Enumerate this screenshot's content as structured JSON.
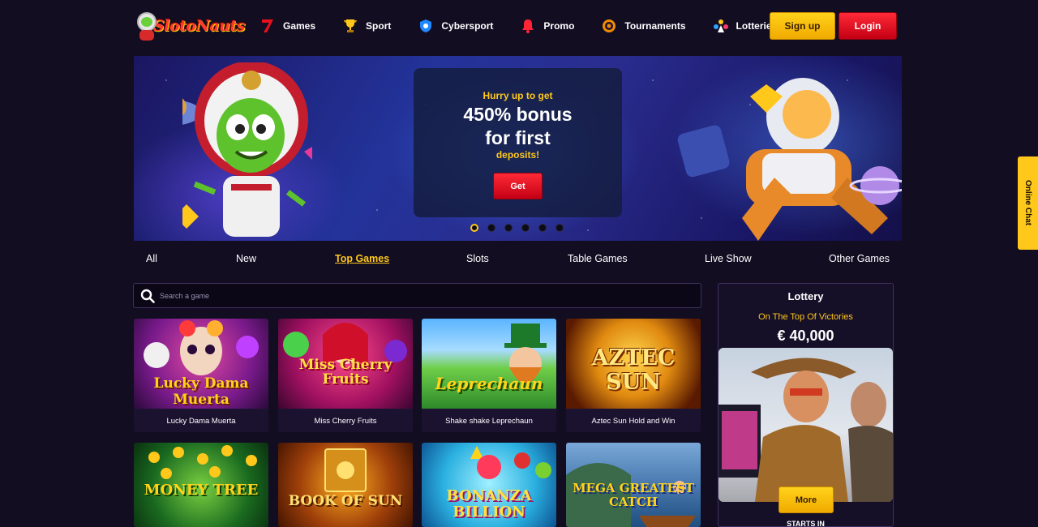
{
  "header": {
    "logo_text": "SlotoNauts",
    "nav": [
      {
        "label": "Games",
        "icon": "seven-icon"
      },
      {
        "label": "Sport",
        "icon": "trophy-icon"
      },
      {
        "label": "Cybersport",
        "icon": "shield-icon"
      },
      {
        "label": "Promo",
        "icon": "bell-icon"
      },
      {
        "label": "Tournaments",
        "icon": "gear-icon"
      },
      {
        "label": "Lotteries",
        "icon": "lottery-icon"
      }
    ],
    "signup_label": "Sign up",
    "login_label": "Login"
  },
  "banner": {
    "pre": "Hurry up to get",
    "main_line1": "450% bonus",
    "main_line2": "for first",
    "post": "deposits!",
    "button": "Get",
    "slide_count": 6,
    "active_slide": 1
  },
  "tabs": [
    "All",
    "New",
    "Top Games",
    "Slots",
    "Table Games",
    "Live Show",
    "Other Games"
  ],
  "active_tab": "Top Games",
  "search": {
    "placeholder": "Search a game"
  },
  "games": [
    {
      "name": "Lucky Dama Muerta",
      "thumb_title": "Lucky Dama Muerta"
    },
    {
      "name": "Miss Cherry Fruits",
      "thumb_title": "Miss Cherry Fruits"
    },
    {
      "name": "Shake shake Leprechaun",
      "thumb_title": "Leprechaun"
    },
    {
      "name": "Aztec Sun Hold and Win",
      "thumb_title": "AZTEC SUN"
    },
    {
      "name": "",
      "thumb_title": "MONEY TREE"
    },
    {
      "name": "",
      "thumb_title": "BOOK OF SUN"
    },
    {
      "name": "",
      "thumb_title": "BONANZA BILLION"
    },
    {
      "name": "",
      "thumb_title": "MEGA GREATEST CATCH"
    }
  ],
  "lottery": {
    "title": "Lottery",
    "subtitle": "On The Top Of Victories",
    "amount": "€ 40,000",
    "more_label": "More",
    "starts_in": "STARTS IN"
  },
  "chat": {
    "label": "Online Chat"
  },
  "colors": {
    "bg": "#130d22",
    "accent": "#ffc81a",
    "red": "#e0101e"
  }
}
